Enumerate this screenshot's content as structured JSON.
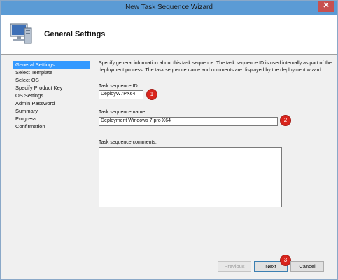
{
  "window": {
    "title": "New Task Sequence Wizard",
    "close_symbol": "✕"
  },
  "header": {
    "title": "General Settings"
  },
  "nav": {
    "items": [
      "General Settings",
      "Select Template",
      "Select OS",
      "Specify Product Key",
      "OS Settings",
      "Admin Password",
      "Summary",
      "Progress",
      "Confirmation"
    ]
  },
  "content": {
    "description": "Specify general information about this task sequence.  The task sequence ID is used internally as part of the deployment process.  The task sequence name and comments are displayed by the deployment wizard.",
    "id_label": "Task sequence ID:",
    "id_value": "DeployW7PX64",
    "name_label": "Task sequence name:",
    "name_value": "Deployment Windows 7 pro X64",
    "comments_label": "Task sequence comments:",
    "comments_value": ""
  },
  "annotations": {
    "one": "1",
    "two": "2",
    "three": "3"
  },
  "buttons": {
    "previous": "Previous",
    "next": "Next",
    "cancel": "Cancel"
  },
  "colors": {
    "accent": "#3399ff",
    "badge": "#d9241c",
    "titlebar": "#5b9bd5"
  },
  "icons": {
    "header": "computer-icon",
    "close": "close-icon"
  }
}
